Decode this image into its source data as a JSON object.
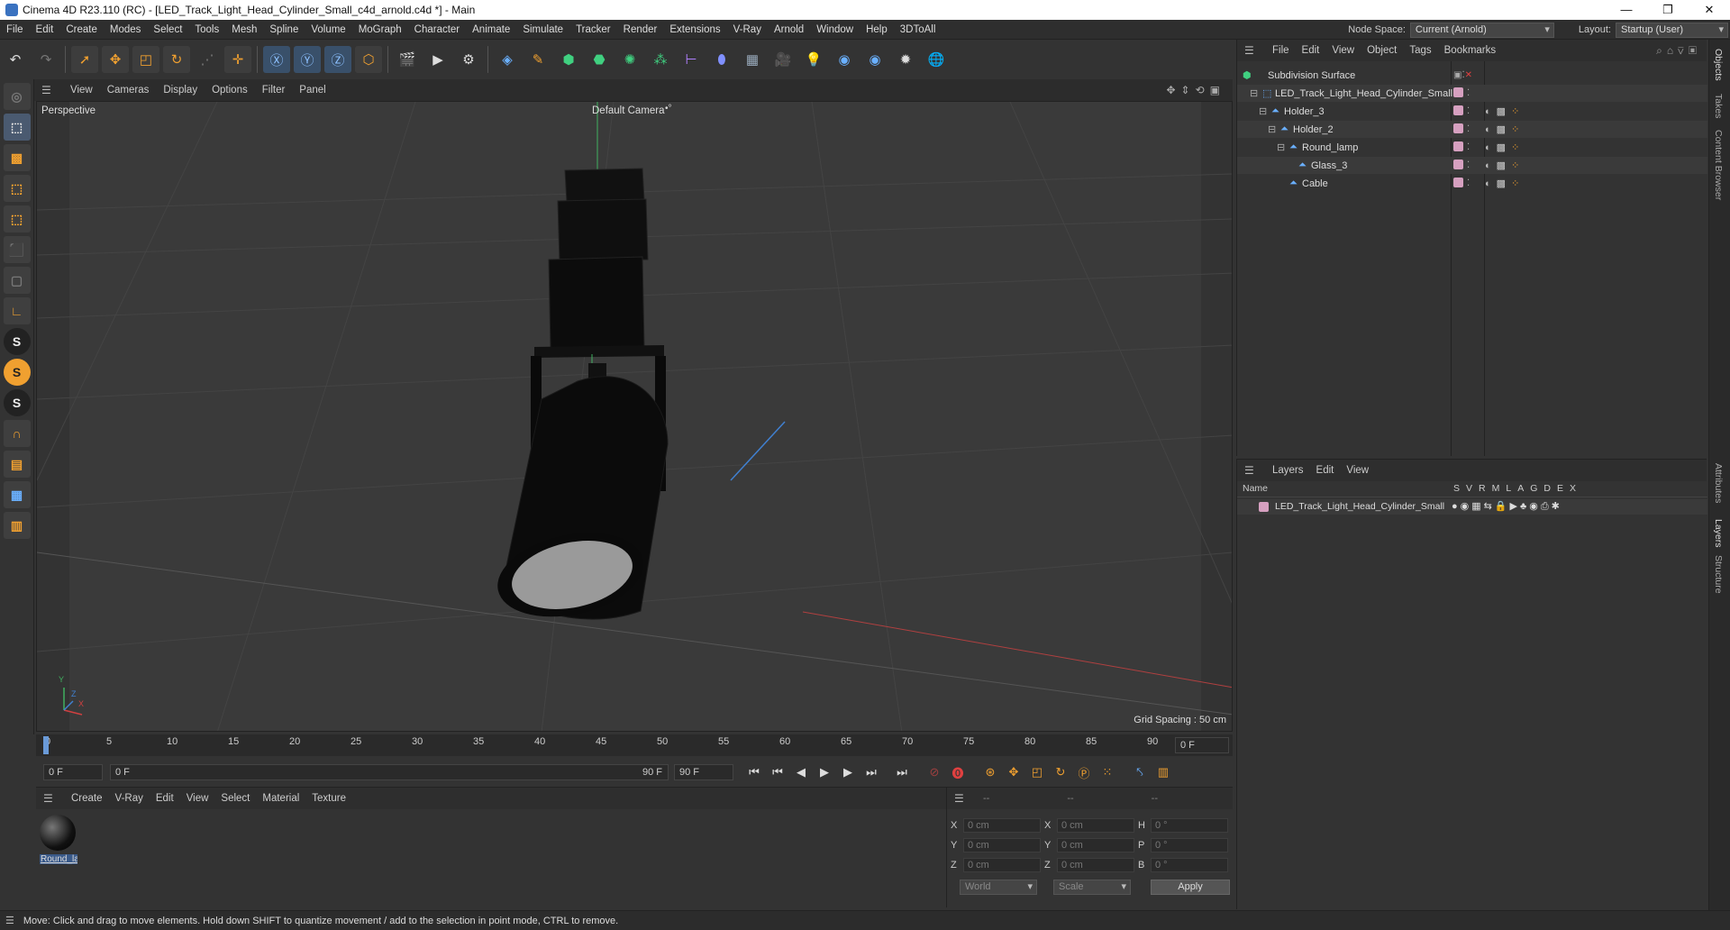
{
  "window": {
    "title": "Cinema 4D R23.110 (RC) - [LED_Track_Light_Head_Cylinder_Small_c4d_arnold.c4d *] - Main",
    "min": "—",
    "max": "❐",
    "close": "✕"
  },
  "menubar": {
    "items": [
      "File",
      "Edit",
      "Create",
      "Modes",
      "Select",
      "Tools",
      "Mesh",
      "Spline",
      "Volume",
      "MoGraph",
      "Character",
      "Animate",
      "Simulate",
      "Tracker",
      "Render",
      "Extensions",
      "V-Ray",
      "Arnold",
      "Window",
      "Help",
      "3DToAll"
    ],
    "node_space_label": "Node Space:",
    "node_space_value": "Current (Arnold)",
    "layout_label": "Layout:",
    "layout_value": "Startup (User)"
  },
  "viewport": {
    "menu": [
      "View",
      "Cameras",
      "Display",
      "Options",
      "Filter",
      "Panel"
    ],
    "label": "Perspective",
    "camera": "Default Camera",
    "camera_icon": "•°",
    "grid_spacing": "Grid Spacing : 50 cm",
    "axis_y": "Y",
    "axis_x": "X",
    "axis_z": "Z"
  },
  "timeline": {
    "ticks": [
      "0",
      "5",
      "10",
      "15",
      "20",
      "25",
      "30",
      "35",
      "40",
      "45",
      "50",
      "55",
      "60",
      "65",
      "70",
      "75",
      "80",
      "85",
      "90"
    ],
    "current_frame": "0 F",
    "start": "0 F",
    "range_start": "0 F",
    "range_end": "90 F",
    "end": "90 F"
  },
  "material_panel": {
    "menu": [
      "Create",
      "V-Ray",
      "Edit",
      "View",
      "Select",
      "Material",
      "Texture"
    ],
    "material_name": "Round_la"
  },
  "coord_panel": {
    "header": [
      "--",
      "--",
      "--"
    ],
    "rows": [
      {
        "a": "X",
        "av": "0 cm",
        "b": "X",
        "bv": "0 cm",
        "c": "H",
        "cv": "0 °"
      },
      {
        "a": "Y",
        "av": "0 cm",
        "b": "Y",
        "bv": "0 cm",
        "c": "P",
        "cv": "0 °"
      },
      {
        "a": "Z",
        "av": "0 cm",
        "b": "Z",
        "bv": "0 cm",
        "c": "B",
        "cv": "0 °"
      }
    ],
    "space": "World",
    "mode": "Scale",
    "apply": "Apply"
  },
  "object_manager": {
    "menu": [
      "File",
      "Edit",
      "View",
      "Object",
      "Tags",
      "Bookmarks"
    ],
    "objects": [
      {
        "name": "Subdivision Surface"
      },
      {
        "name": "LED_Track_Light_Head_Cylinder_Small"
      },
      {
        "name": "Holder_3"
      },
      {
        "name": "Holder_2"
      },
      {
        "name": "Round_lamp"
      },
      {
        "name": "Glass_3"
      },
      {
        "name": "Cable"
      }
    ]
  },
  "layer_manager": {
    "menu": [
      "Layers",
      "Edit",
      "View"
    ],
    "col_name": "Name",
    "cols": [
      "S",
      "V",
      "R",
      "M",
      "L",
      "A",
      "G",
      "D",
      "E",
      "X"
    ],
    "layer_name": "LED_Track_Light_Head_Cylinder_Small"
  },
  "side_tabs": [
    "Objects",
    "Takes",
    "Content Browser",
    "Attributes",
    "Layers",
    "Structure"
  ],
  "status": "Move: Click and drag to move elements. Hold down SHIFT to quantize movement / add to the selection in point mode, CTRL to remove.",
  "colors": {
    "accent": "#f0a030",
    "layer": "#d6a0c0"
  }
}
